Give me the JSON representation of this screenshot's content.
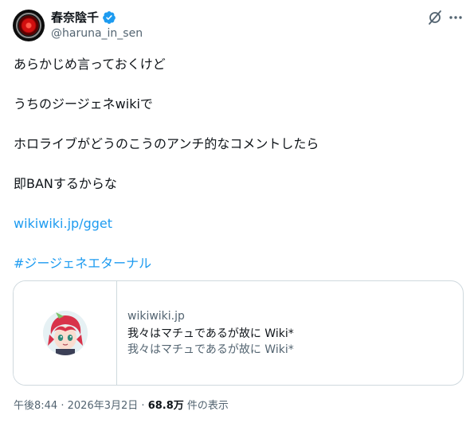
{
  "author": {
    "display_name": "春奈陰千",
    "handle": "@haruna_in_sen",
    "verified_color": "#1d9bf0"
  },
  "tweet": {
    "lines": [
      "あらかじめ言っておくけど",
      "うちのジージェネwikiで",
      "ホロライブがどうのこうのアンチ的なコメントしたら",
      "即BANするからな"
    ],
    "link": "wikiwiki.jp/gget",
    "hashtag": "#ジージェネエターナル"
  },
  "card": {
    "domain": "wikiwiki.jp",
    "title": "我々はマチュであるが故に Wiki*",
    "description": "我々はマチュであるが故に Wiki*"
  },
  "meta": {
    "time": "午後8:44",
    "separator": "·",
    "date": "2026年3月2日",
    "views": "68.8万",
    "views_label": "件の表示"
  },
  "icons": [
    "hal-avatar",
    "verified-badge-icon",
    "grok-icon",
    "more-icon",
    "card-avatar"
  ]
}
